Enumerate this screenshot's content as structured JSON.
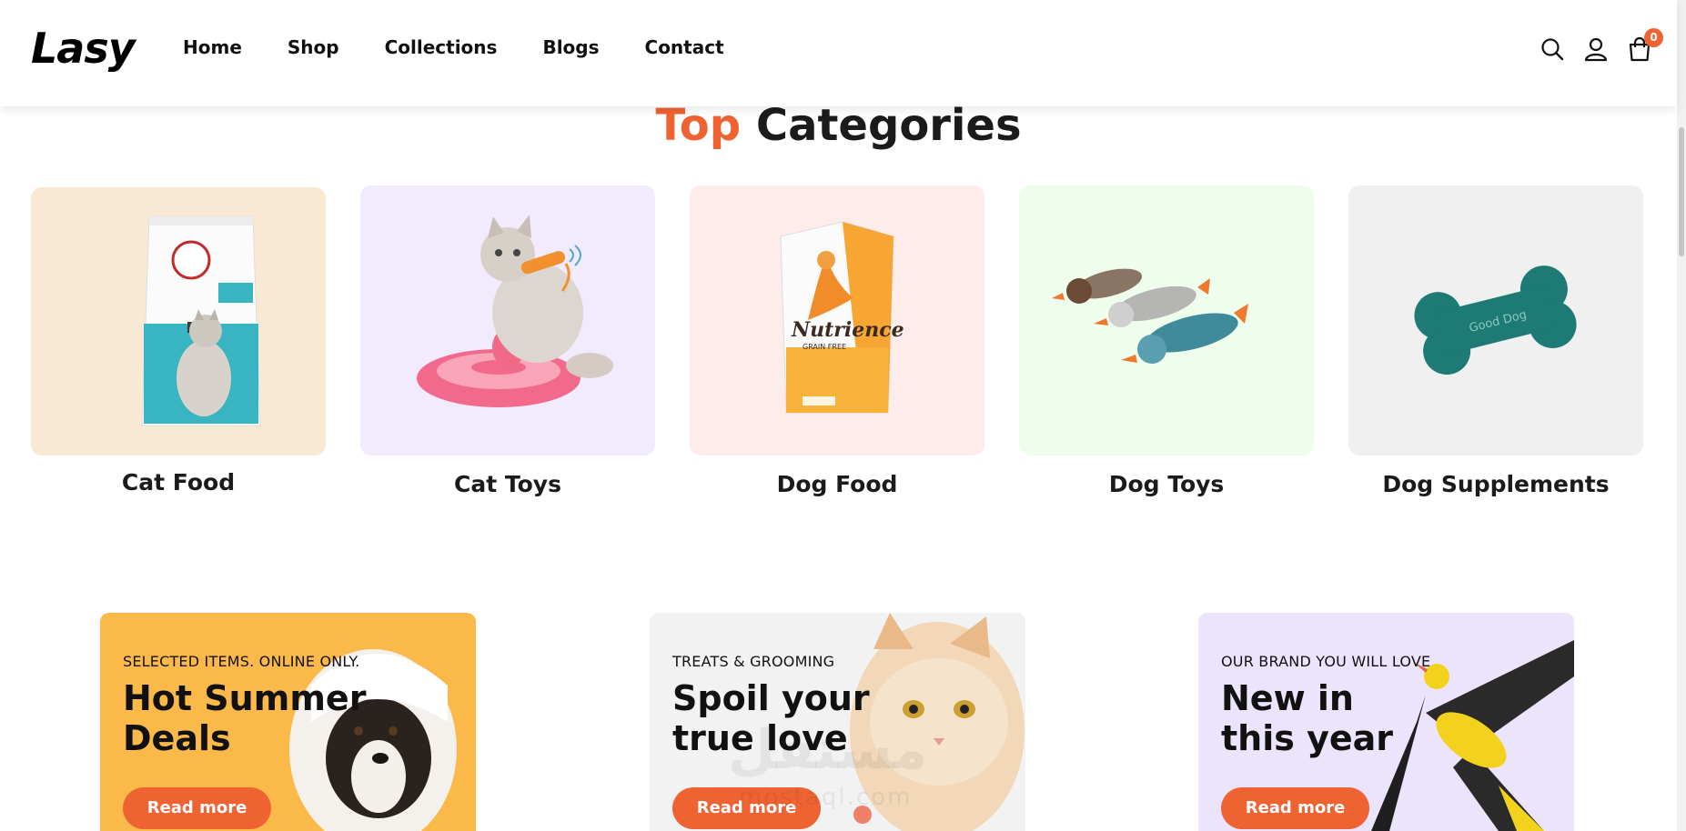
{
  "header": {
    "logo": "Lasy",
    "nav": [
      {
        "label": "Home"
      },
      {
        "label": "Shop"
      },
      {
        "label": "Collections"
      },
      {
        "label": "Blogs"
      },
      {
        "label": "Contact"
      }
    ],
    "icons": [
      "search-icon",
      "user-icon",
      "cart-icon"
    ],
    "cart_count": "0"
  },
  "section": {
    "title_accent": "Top",
    "title_rest": " Categories"
  },
  "categories": [
    {
      "label": "Cat Food",
      "bg": "#f9e9d4"
    },
    {
      "label": "Cat Toys",
      "bg": "#f1ebfd"
    },
    {
      "label": "Dog Food",
      "bg": "#fdecea"
    },
    {
      "label": "Dog Toys",
      "bg": "#eefdec"
    },
    {
      "label": "Dog Supplements",
      "bg": "#f0f0f0"
    }
  ],
  "promos": [
    {
      "kicker": "SELECTED ITEMS. ONLINE ONLY.",
      "title": "Hot Summer Deals",
      "button": "Read more",
      "bg": "#fbb94a"
    },
    {
      "kicker": "TREATS & GROOMING",
      "title": "Spoil your true love",
      "button": "Read more",
      "bg": "#f2f2f2"
    },
    {
      "kicker": "OUR BRAND YOU WILL LOVE",
      "title": "New in this year",
      "button": "Read more",
      "bg": "#ece3fc"
    }
  ],
  "watermark": {
    "text": "مستقل",
    "sub": "mostaql.com"
  },
  "colors": {
    "accent": "#ee6331",
    "text": "#1b1b1b"
  }
}
